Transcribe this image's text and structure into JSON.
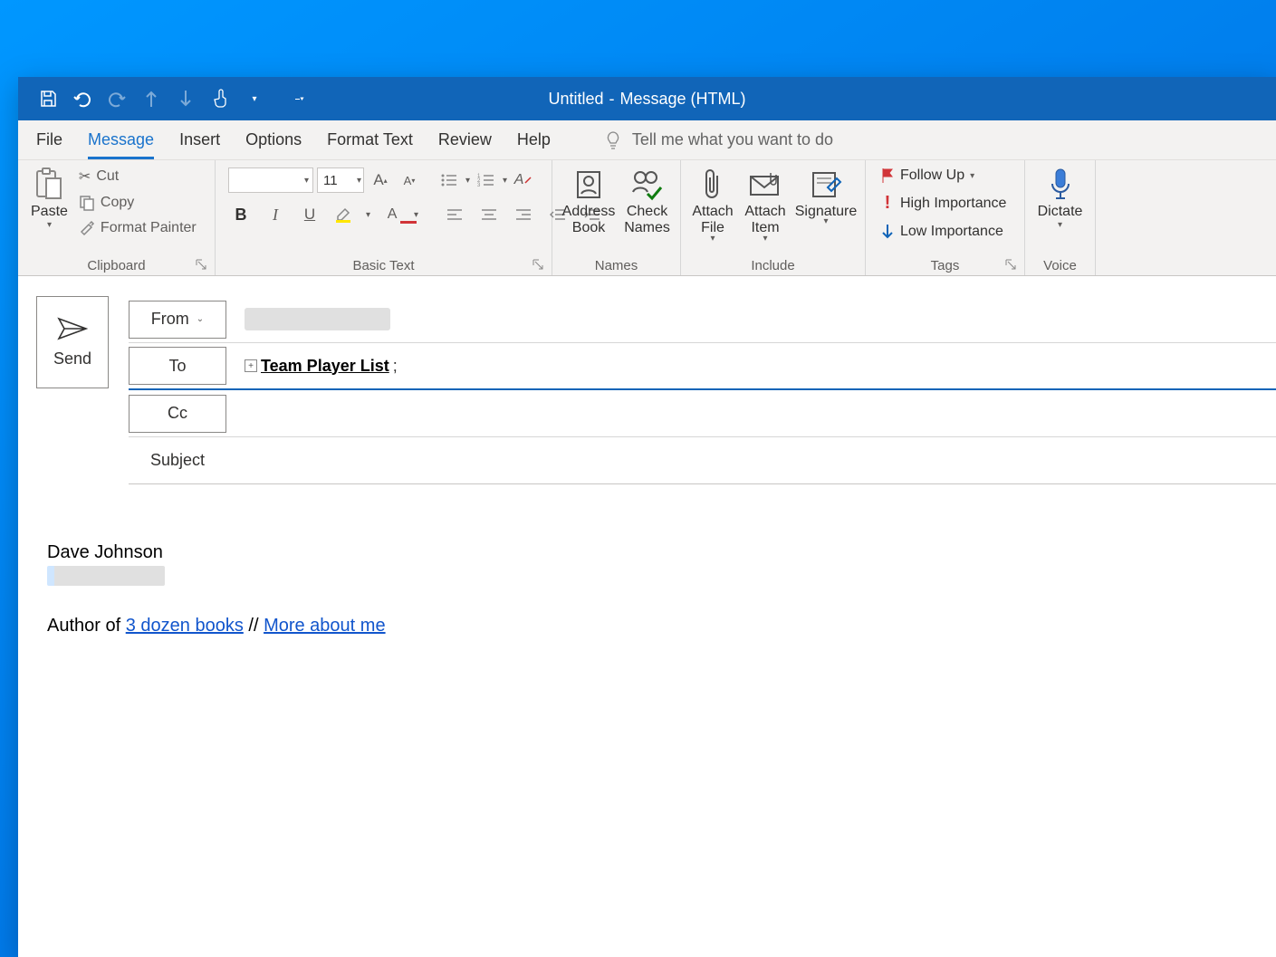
{
  "title": {
    "prefix": "Untitled",
    "sep": "-",
    "suffix": "Message (HTML)"
  },
  "tabs": {
    "file": "File",
    "message": "Message",
    "insert": "Insert",
    "options": "Options",
    "format_text": "Format Text",
    "review": "Review",
    "help": "Help",
    "tellme": "Tell me what you want to do"
  },
  "ribbon": {
    "clipboard": {
      "paste": "Paste",
      "cut": "Cut",
      "copy": "Copy",
      "painter": "Format Painter",
      "label": "Clipboard"
    },
    "basictext": {
      "font_size": "11",
      "label": "Basic Text"
    },
    "names": {
      "address_book": "Address\nBook",
      "check_names": "Check\nNames",
      "label": "Names"
    },
    "include": {
      "attach_file": "Attach\nFile",
      "attach_item": "Attach\nItem",
      "signature": "Signature",
      "label": "Include"
    },
    "tags": {
      "follow_up": "Follow Up",
      "high": "High Importance",
      "low": "Low Importance",
      "label": "Tags"
    },
    "voice": {
      "dictate": "Dictate",
      "label": "Voice"
    }
  },
  "compose": {
    "send": "Send",
    "from": "From",
    "to": "To",
    "cc": "Cc",
    "subject": "Subject",
    "to_value": "Team Player List",
    "to_suffix": ";"
  },
  "body": {
    "name": "Dave Johnson",
    "author_prefix": "Author of ",
    "link1": "3 dozen books",
    "sep": " // ",
    "link2": "More about me"
  }
}
